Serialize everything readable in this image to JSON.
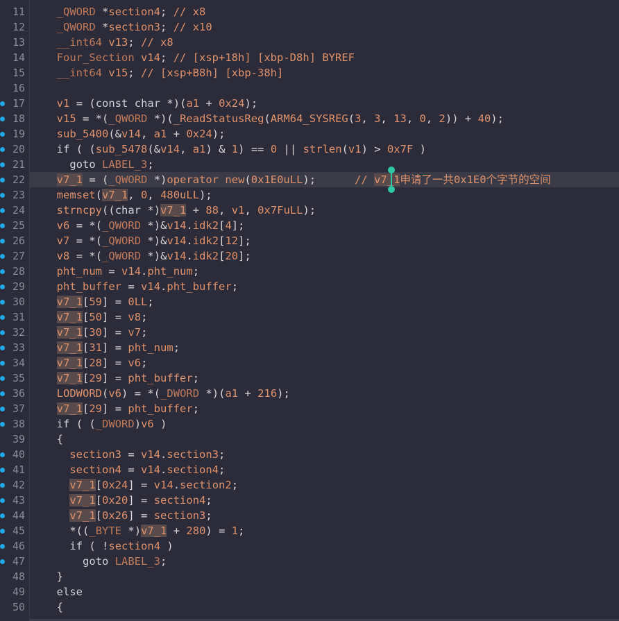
{
  "lines": [
    {
      "n": "11",
      "bp": false,
      "code": "  _QWORD *section4; // x8"
    },
    {
      "n": "12",
      "bp": false,
      "code": "  _QWORD *section3; // x10"
    },
    {
      "n": "13",
      "bp": false,
      "code": "  __int64 v13; // x8"
    },
    {
      "n": "14",
      "bp": false,
      "code": "  Four_Section v14; // [xsp+18h] [xbp-D8h] BYREF"
    },
    {
      "n": "15",
      "bp": false,
      "code": "  __int64 v15; // [xsp+B8h] [xbp-38h]"
    },
    {
      "n": "16",
      "bp": false,
      "code": ""
    },
    {
      "n": "17",
      "bp": true,
      "code": "  v1 = (const char *)(a1 + 0x24);"
    },
    {
      "n": "18",
      "bp": true,
      "code": "  v15 = *(_QWORD *)(_ReadStatusReg(ARM64_SYSREG(3, 3, 13, 0, 2)) + 40);"
    },
    {
      "n": "19",
      "bp": true,
      "code": "  sub_5400(&v14, a1 + 0x24);"
    },
    {
      "n": "20",
      "bp": true,
      "code": "  if ( (sub_5478(&v14, a1) & 1) == 0 || strlen(v1) > 0x7F )"
    },
    {
      "n": "21",
      "bp": true,
      "code": "    goto LABEL_3;"
    },
    {
      "n": "22",
      "bp": true,
      "code": "  v7_1 = (_QWORD *)operator new(0x1E0uLL);      // v7_1申请了一共0x1E0个字节的空间"
    },
    {
      "n": "23",
      "bp": true,
      "code": "  memset(v7_1, 0, 480uLL);"
    },
    {
      "n": "24",
      "bp": true,
      "code": "  strncpy((char *)v7_1 + 88, v1, 0x7FuLL);"
    },
    {
      "n": "25",
      "bp": true,
      "code": "  v6 = *(_QWORD *)&v14.idk2[4];"
    },
    {
      "n": "26",
      "bp": true,
      "code": "  v7 = *(_QWORD *)&v14.idk2[12];"
    },
    {
      "n": "27",
      "bp": true,
      "code": "  v8 = *(_QWORD *)&v14.idk2[20];"
    },
    {
      "n": "28",
      "bp": true,
      "code": "  pht_num = v14.pht_num;"
    },
    {
      "n": "29",
      "bp": true,
      "code": "  pht_buffer = v14.pht_buffer;"
    },
    {
      "n": "30",
      "bp": true,
      "code": "  v7_1[59] = 0LL;"
    },
    {
      "n": "31",
      "bp": true,
      "code": "  v7_1[50] = v8;"
    },
    {
      "n": "32",
      "bp": true,
      "code": "  v7_1[30] = v7;"
    },
    {
      "n": "33",
      "bp": true,
      "code": "  v7_1[31] = pht_num;"
    },
    {
      "n": "34",
      "bp": true,
      "code": "  v7_1[28] = v6;"
    },
    {
      "n": "35",
      "bp": true,
      "code": "  v7_1[29] = pht_buffer;"
    },
    {
      "n": "36",
      "bp": true,
      "code": "  LODWORD(v6) = *(_DWORD *)(a1 + 216);"
    },
    {
      "n": "37",
      "bp": true,
      "code": "  v7_1[29] = pht_buffer;"
    },
    {
      "n": "38",
      "bp": true,
      "code": "  if ( (_DWORD)v6 )"
    },
    {
      "n": "39",
      "bp": false,
      "code": "  {"
    },
    {
      "n": "40",
      "bp": true,
      "code": "    section3 = v14.section3;"
    },
    {
      "n": "41",
      "bp": true,
      "code": "    section4 = v14.section4;"
    },
    {
      "n": "42",
      "bp": true,
      "code": "    v7_1[0x24] = v14.section2;"
    },
    {
      "n": "43",
      "bp": true,
      "code": "    v7_1[0x20] = section4;"
    },
    {
      "n": "44",
      "bp": true,
      "code": "    v7_1[0x26] = section3;"
    },
    {
      "n": "45",
      "bp": true,
      "code": "    *((_BYTE *)v7_1 + 280) = 1;"
    },
    {
      "n": "46",
      "bp": true,
      "code": "    if ( !section4 )"
    },
    {
      "n": "47",
      "bp": true,
      "code": "      goto LABEL_3;"
    },
    {
      "n": "48",
      "bp": false,
      "code": "  }"
    },
    {
      "n": "49",
      "bp": false,
      "code": "  else"
    },
    {
      "n": "50",
      "bp": false,
      "code": "  {"
    }
  ],
  "current_line": "22",
  "colors": {
    "background": "#2b2b3a",
    "identifier": "#e0926b",
    "keyword": "#cfd2dc",
    "breakpoint": "#1fa9e6",
    "caret": "#2dc9a6",
    "selection": "#594a4b"
  }
}
